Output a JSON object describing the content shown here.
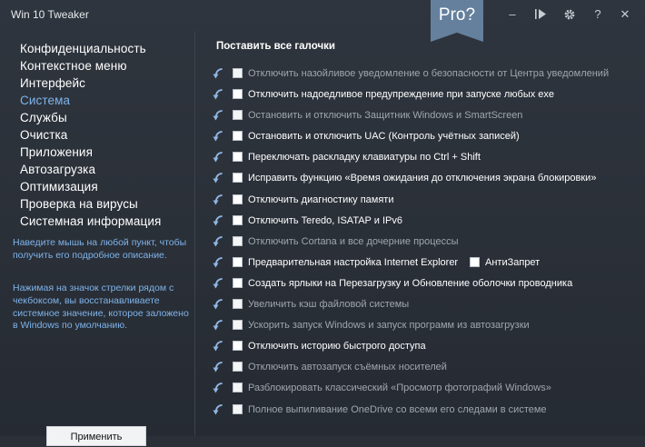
{
  "app": {
    "title": "Win 10 Tweaker",
    "pro_badge": "Pro?",
    "title_buttons": {
      "minimize": "–",
      "help": "?",
      "close": "✕"
    }
  },
  "sidebar": {
    "items": [
      {
        "label": "Конфиденциальность",
        "active": false
      },
      {
        "label": "Контекстное меню",
        "active": false
      },
      {
        "label": "Интерфейс",
        "active": false
      },
      {
        "label": "Система",
        "active": true
      },
      {
        "label": "Службы",
        "active": false
      },
      {
        "label": "Очистка",
        "active": false
      },
      {
        "label": "Приложения",
        "active": false
      },
      {
        "label": "Автозагрузка",
        "active": false
      },
      {
        "label": "Оптимизация",
        "active": false
      },
      {
        "label": "Проверка на вирусы",
        "active": false
      },
      {
        "label": "Системная информация",
        "active": false
      }
    ],
    "hint1": "Наведите мышь на любой пункт, чтобы получить его подробное описание.",
    "hint2": "Нажимая на значок стрелки рядом с чекбоксом, вы восстанавливаете системное значение, которое заложено в Windows по умолчанию.",
    "apply_label": "Применить"
  },
  "main": {
    "select_all_label": "Поставить все галочки",
    "tweaks": [
      {
        "label": "Отключить назойливое уведомление о безопасности от Центра уведомлений",
        "enabled": false
      },
      {
        "label": "Отключить надоедливое предупреждение при запуске любых exe",
        "enabled": true
      },
      {
        "label": "Остановить и отключить Защитник Windows и SmartScreen",
        "enabled": false
      },
      {
        "label": "Остановить и отключить UAC (Контроль учётных записей)",
        "enabled": true
      },
      {
        "label": "Переключать раскладку клавиатуры по Ctrl + Shift",
        "enabled": true
      },
      {
        "label": "Исправить функцию «Время ожидания до отключения экрана блокировки»",
        "enabled": true
      },
      {
        "label": "Отключить диагностику памяти",
        "enabled": true
      },
      {
        "label": "Отключить Teredo, ISATAP и IPv6",
        "enabled": true
      },
      {
        "label": "Отключить Cortana и все дочерние процессы",
        "enabled": false
      },
      {
        "label": "Предварительная настройка Internet Explorer",
        "enabled": true,
        "extra_label": "АнтиЗапрет"
      },
      {
        "label": "Создать ярлыки на Перезагрузку и Обновление оболочки проводника",
        "enabled": true
      },
      {
        "label": "Увеличить кэш файловой системы",
        "enabled": false
      },
      {
        "label": "Ускорить запуск Windows и запуск программ из автозагрузки",
        "enabled": false
      },
      {
        "label": "Отключить историю быстрого доступа",
        "enabled": true
      },
      {
        "label": "Отключить автозапуск съёмных носителей",
        "enabled": false
      },
      {
        "label": "Разблокировать классический «Просмотр фотографий Windows»",
        "enabled": false
      },
      {
        "label": "Полное выпиливание OneDrive со всеми его следами в системе",
        "enabled": false
      }
    ]
  },
  "colors": {
    "background": "#2b3038",
    "accent": "#7fb4ea",
    "pro_badge": "#64809d",
    "disabled_text": "#a0a6ae"
  },
  "icons": {
    "restore_arrow": "restore-arrow-icon",
    "title_play": "play-icon",
    "title_settings": "gear-icon"
  }
}
